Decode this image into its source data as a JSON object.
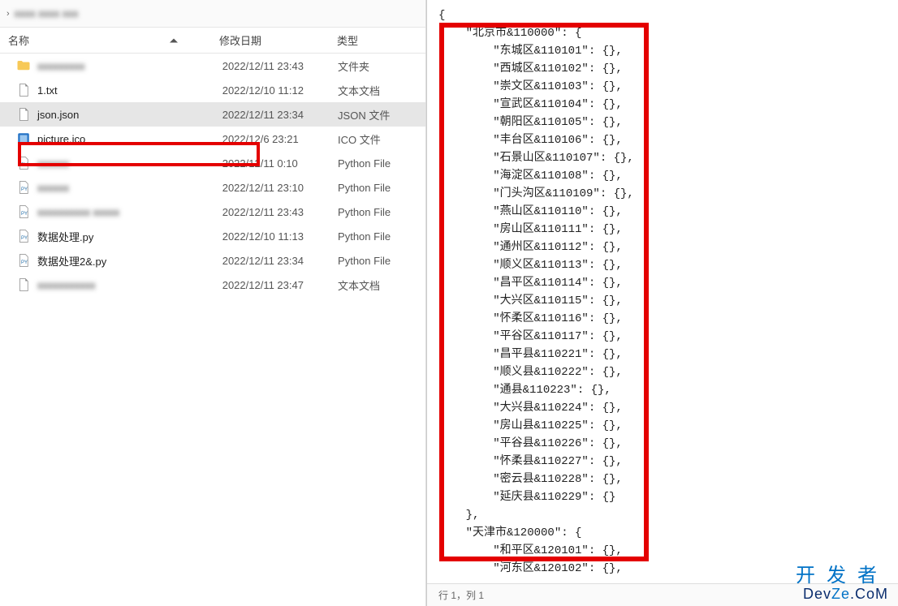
{
  "breadcrumb": {
    "blurred_path": "xxxx xxxx xxx"
  },
  "columns": {
    "name": "名称",
    "date": "修改日期",
    "type": "类型"
  },
  "files": [
    {
      "name": "xxxxxxxxx",
      "date": "2022/12/11 23:43",
      "type": "文件夹",
      "icon": "folder",
      "blur": true
    },
    {
      "name": "1.txt",
      "date": "2022/12/10 11:12",
      "type": "文本文档",
      "icon": "txt",
      "blur": false
    },
    {
      "name": "json.json",
      "date": "2022/12/11 23:34",
      "type": "JSON 文件",
      "icon": "txt",
      "blur": false,
      "selected": true
    },
    {
      "name": "picture.ico",
      "date": "2022/12/6 23:21",
      "type": "ICO 文件",
      "icon": "ico",
      "blur": false
    },
    {
      "name": "xxxxxx",
      "date": "2022/12/11 0:10",
      "type": "Python File",
      "icon": "py",
      "blur": true
    },
    {
      "name": "xxxxxx",
      "date": "2022/12/11 23:10",
      "type": "Python File",
      "icon": "py",
      "blur": true
    },
    {
      "name": "xxxxxxxxxx xxxxx",
      "date": "2022/12/11 23:43",
      "type": "Python File",
      "icon": "py",
      "blur": true
    },
    {
      "name": "数据处理.py",
      "date": "2022/12/10 11:13",
      "type": "Python File",
      "icon": "py",
      "blur": false
    },
    {
      "name": "数据处理2&.py",
      "date": "2022/12/11 23:34",
      "type": "Python File",
      "icon": "py",
      "blur": false
    },
    {
      "name": "xxxxxxxxxxx",
      "date": "2022/12/11 23:47",
      "type": "文本文档",
      "icon": "txt",
      "blur": true
    }
  ],
  "editor": {
    "status": "行 1，列 1",
    "lines": [
      "{",
      "    \"北京市&110000\": {",
      "        \"东城区&110101\": {},",
      "        \"西城区&110102\": {},",
      "        \"崇文区&110103\": {},",
      "        \"宣武区&110104\": {},",
      "        \"朝阳区&110105\": {},",
      "        \"丰台区&110106\": {},",
      "        \"石景山区&110107\": {},",
      "        \"海淀区&110108\": {},",
      "        \"门头沟区&110109\": {},",
      "        \"燕山区&110110\": {},",
      "        \"房山区&110111\": {},",
      "        \"通州区&110112\": {},",
      "        \"顺义区&110113\": {},",
      "        \"昌平区&110114\": {},",
      "        \"大兴区&110115\": {},",
      "        \"怀柔区&110116\": {},",
      "        \"平谷区&110117\": {},",
      "        \"昌平县&110221\": {},",
      "        \"顺义县&110222\": {},",
      "        \"通县&110223\": {},",
      "        \"大兴县&110224\": {},",
      "        \"房山县&110225\": {},",
      "        \"平谷县&110226\": {},",
      "        \"怀柔县&110227\": {},",
      "        \"密云县&110228\": {},",
      "        \"延庆县&110229\": {}",
      "    },",
      "    \"天津市&120000\": {",
      "        \"和平区&120101\": {},",
      "        \"河东区&120102\": {},"
    ]
  },
  "watermark": {
    "cn": "开发者",
    "en_dev": "Dev",
    "en_ze": "Ze",
    "en_com": ".CoM"
  }
}
